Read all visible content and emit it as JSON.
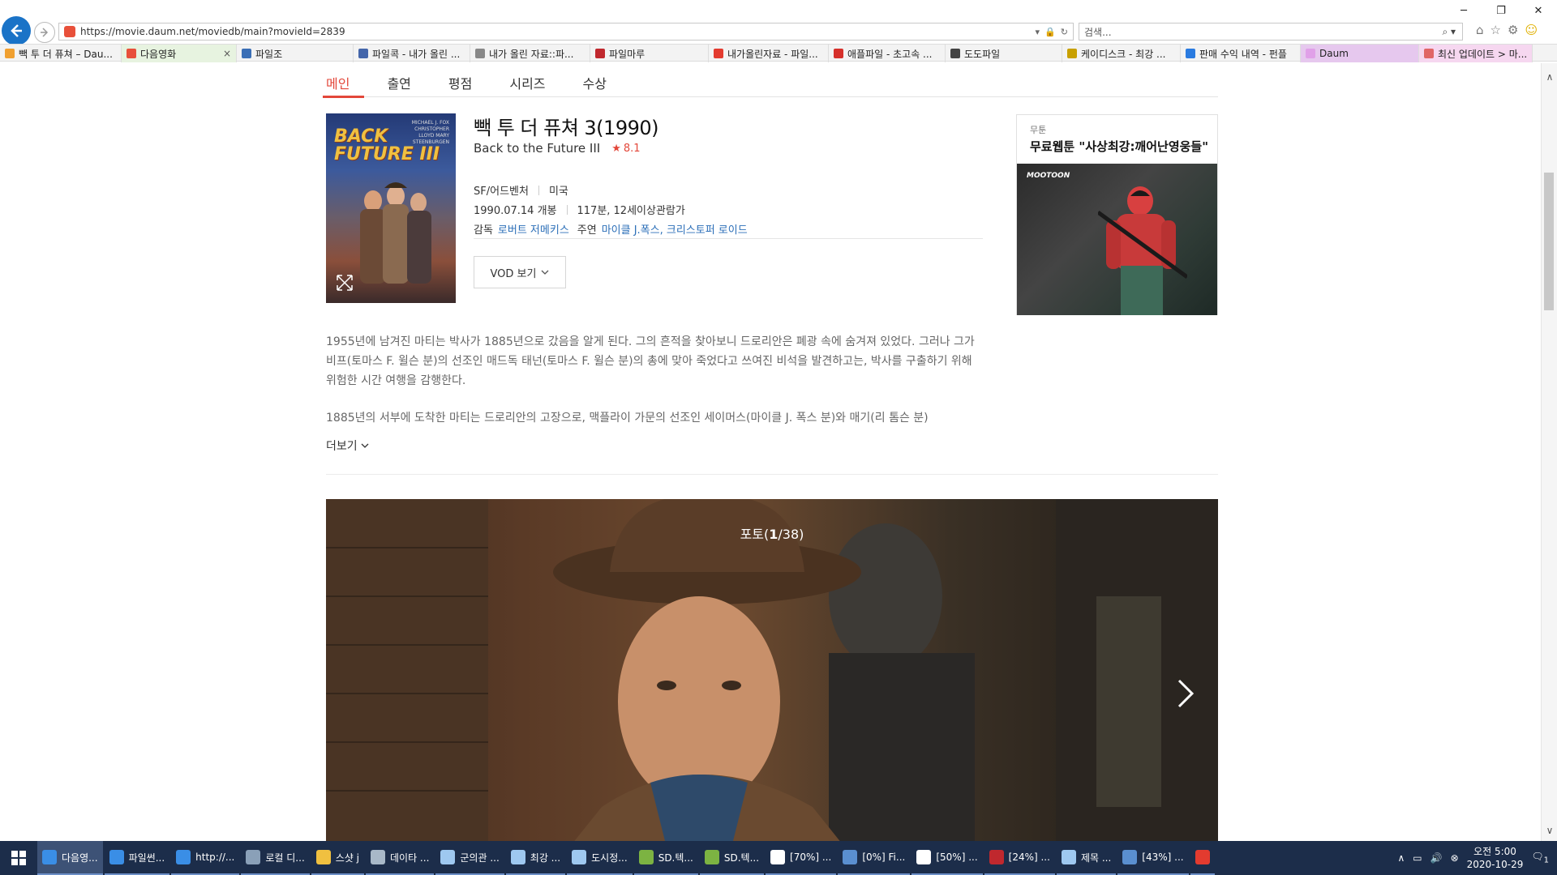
{
  "browser": {
    "url": "https://movie.daum.net/moviedb/main?movieId=2839",
    "search_placeholder": "검색...",
    "tabs": [
      {
        "label": "빽 투 더 퓨쳐 – Dau...",
        "color": "#f0a030"
      },
      {
        "label": "다음영화",
        "color": "#e8503a",
        "close": "×"
      },
      {
        "label": "파일조",
        "color": "#3b6fb6"
      },
      {
        "label": "파일콕 - 내가 올린 ...",
        "color": "#4466aa"
      },
      {
        "label": "내가 올린 자료::파...",
        "color": "#888888"
      },
      {
        "label": "파일마루",
        "color": "#c0282e"
      },
      {
        "label": "내가올린자료 - 파일...",
        "color": "#e33b2f"
      },
      {
        "label": "애플파일 - 초고속 ...",
        "color": "#d6302b"
      },
      {
        "label": "도도파일",
        "color": "#444444"
      },
      {
        "label": "케이디스크 - 최강 ...",
        "color": "#c8a000"
      },
      {
        "label": "판매 수익 내역 - 펀플",
        "color": "#2a7be0"
      },
      {
        "label": "Daum",
        "color": "#e0a0e8"
      },
      {
        "label": "최신 업데이트 > 마...",
        "color": "#e06666"
      }
    ]
  },
  "menu": {
    "items": [
      "메인",
      "출연",
      "평점",
      "시리즈",
      "수상"
    ]
  },
  "poster": {
    "title_line1": "BACK",
    "title_line2": "FUTURE III",
    "credit": "MICHAEL J. FOX CHRISTOPHER LLOYD MARY STEENBURGEN"
  },
  "movie": {
    "title_ko": "빽 투 더 퓨쳐 3(1990)",
    "title_en": "Back to the Future III",
    "rating_star": "★",
    "rating": "8.1",
    "genre": "SF/어드벤처",
    "country": "미국",
    "release": "1990.07.14 개봉",
    "runtime": "117분, 12세이상관람가",
    "director_label": "감독",
    "director": "로버트 저메키스",
    "cast_label": "주연",
    "cast": "마이클 J.폭스, 크리스토퍼 로이드",
    "vod_label": "VOD 보기",
    "synopsis_1": "1955년에 남겨진 마티는 박사가 1885년으로 갔음을 알게 된다. 그의 흔적을 찾아보니 드로리안은 폐광 속에 숨겨져 있었다. 그러나 그가 비프(토마스 F. 윌슨 분)의 선조인 매드독 태넌(토마스 F. 윌슨 분)의 총에 맞아 죽었다고 쓰여진 비석을 발견하고는, 박사를 구출하기 위해 위험한 시간 여행을 감행한다.",
    "synopsis_2": "1885년의 서부에 도착한 마티는 드로리안의 고장으로, 맥플라이 가문의 선조인 세이머스(마이클 J. 폭스 분)와 매기(리 톰슨 분)",
    "more_label": "더보기"
  },
  "ad": {
    "label": "무툰",
    "title": "무료웹툰 \"사상최강:깨어난영웅들\"",
    "brand": "MOOTOON"
  },
  "photo": {
    "label": "포토(",
    "current": "1",
    "rest": "/38)"
  },
  "taskbar": {
    "items": [
      {
        "label": "다음영...",
        "color": "#3a8ee6",
        "active": true
      },
      {
        "label": "파일썬...",
        "color": "#3a8ee6"
      },
      {
        "label": "http://...",
        "color": "#3a8ee6"
      },
      {
        "label": "로컬 디...",
        "color": "#8aa0b8"
      },
      {
        "label": "스샷 j",
        "color": "#f0c040"
      },
      {
        "label": "데이타 ...",
        "color": "#a8b8c8"
      },
      {
        "label": "군의관 ...",
        "color": "#9ec8f0"
      },
      {
        "label": "최강 ...",
        "color": "#9ec8f0"
      },
      {
        "label": "도시정...",
        "color": "#9ec8f0"
      },
      {
        "label": "SD.텍...",
        "color": "#7cb342"
      },
      {
        "label": "SD.텍...",
        "color": "#7cb342"
      },
      {
        "label": "[70%] ...",
        "color": "#ffffff"
      },
      {
        "label": "[0%] Fi...",
        "color": "#5a8fd0"
      },
      {
        "label": "[50%] ...",
        "color": "#ffffff"
      },
      {
        "label": "[24%] ...",
        "color": "#c0282e"
      },
      {
        "label": "제목 ...",
        "color": "#9ec8f0"
      },
      {
        "label": "[43%] ...",
        "color": "#5a8fd0"
      },
      {
        "label": "",
        "color": "#e33b2f"
      }
    ],
    "time": "오전 5:00",
    "date": "2020-10-29",
    "notif_count": "1"
  }
}
